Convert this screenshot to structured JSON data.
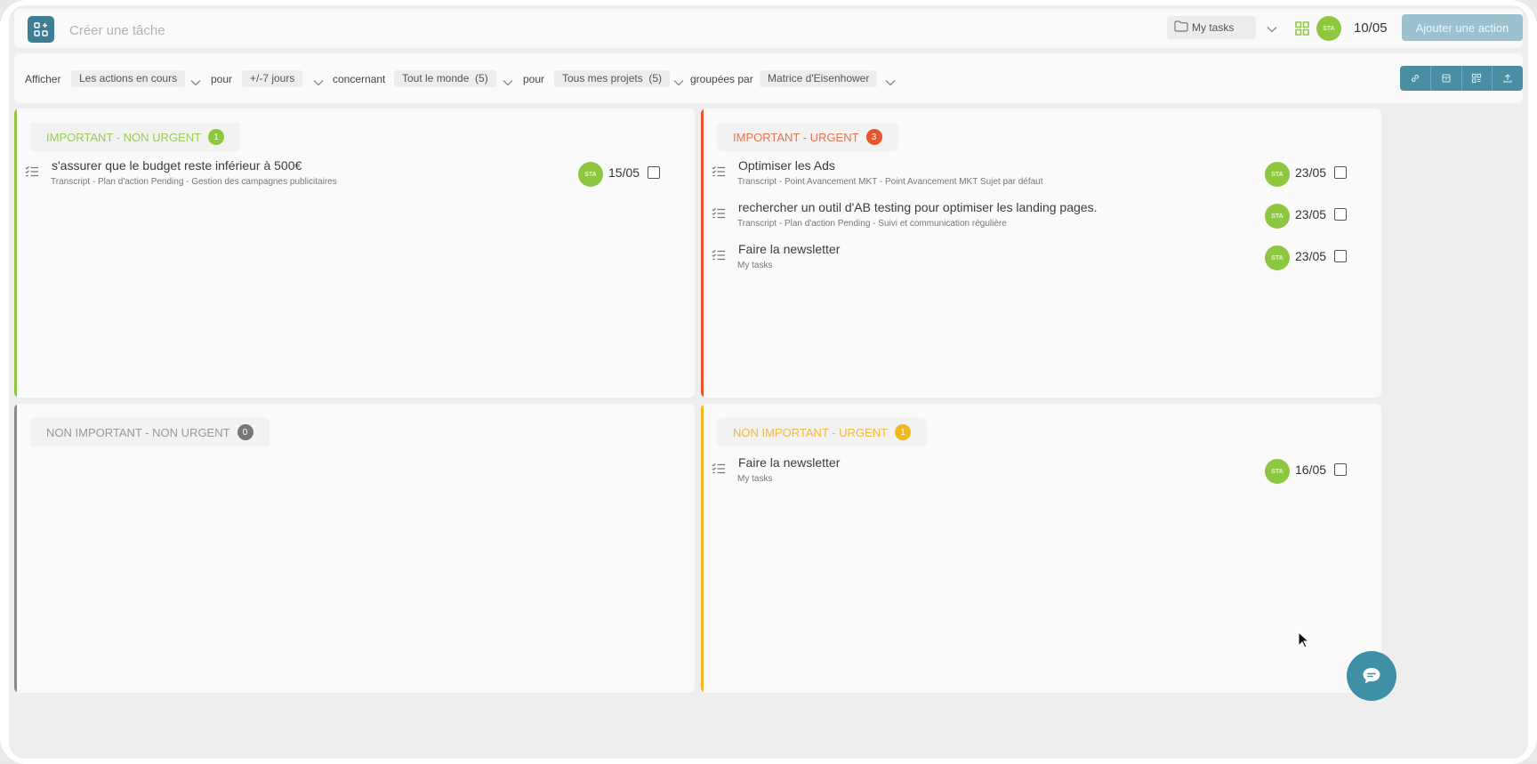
{
  "topbar": {
    "create_placeholder": "Créer une tâche",
    "project": "My tasks",
    "avatar": "STA",
    "date": "10/05",
    "add_button": "Ajouter une action"
  },
  "filters": {
    "afficher": "Afficher",
    "afficher_value": "Les actions en cours",
    "pour": "pour",
    "period_value": "+/-7 jours",
    "concernant": "concernant",
    "people_value": "Tout le monde  (5)",
    "pour2": "pour",
    "projects_value": "Tous mes projets  (5)",
    "groupees": "groupées par",
    "group_value": "Matrice d'Eisenhower"
  },
  "quadrants": {
    "important_non_urgent": {
      "label": "IMPORTANT - NON URGENT",
      "count": "1",
      "color": "#8dc63f",
      "tasks": [
        {
          "title": "s'assurer que le budget reste inférieur à 500€",
          "sub": "Transcript - Plan d'action Pending - Gestion des campagnes publicitaires",
          "avatar": "STA",
          "date": "15/05"
        }
      ]
    },
    "important_urgent": {
      "label": "IMPORTANT - URGENT",
      "count": "3",
      "color": "#e8552b",
      "tasks": [
        {
          "title": "Optimiser les Ads",
          "sub": "Transcript - Point Avancement MKT - Point Avancement MKT Sujet par défaut",
          "avatar": "STA",
          "date": "23/05"
        },
        {
          "title": "rechercher un outil d'AB testing pour optimiser les landing pages.",
          "sub": "Transcript - Plan d'action Pending - Suivi et communication régulière",
          "avatar": "STA",
          "date": "23/05"
        },
        {
          "title": "Faire la newsletter",
          "sub": "My tasks",
          "avatar": "STA",
          "date": "23/05"
        }
      ]
    },
    "non_important_non_urgent": {
      "label": "NON IMPORTANT - NON URGENT",
      "count": "0",
      "color": "#8a8a8a",
      "tasks": []
    },
    "non_important_urgent": {
      "label": "NON IMPORTANT - URGENT",
      "count": "1",
      "color": "#f3b821",
      "tasks": [
        {
          "title": "Faire la newsletter",
          "sub": "My tasks",
          "avatar": "STA",
          "date": "16/05"
        }
      ]
    }
  },
  "icons": {
    "app": "grid-plus-icon",
    "project": "folder-icon",
    "view": "grid-view-icon",
    "toolbar": [
      "link-icon",
      "archive-icon",
      "qr-icon",
      "upload-icon"
    ],
    "task": "checklist-icon",
    "chat": "chat-icon"
  }
}
